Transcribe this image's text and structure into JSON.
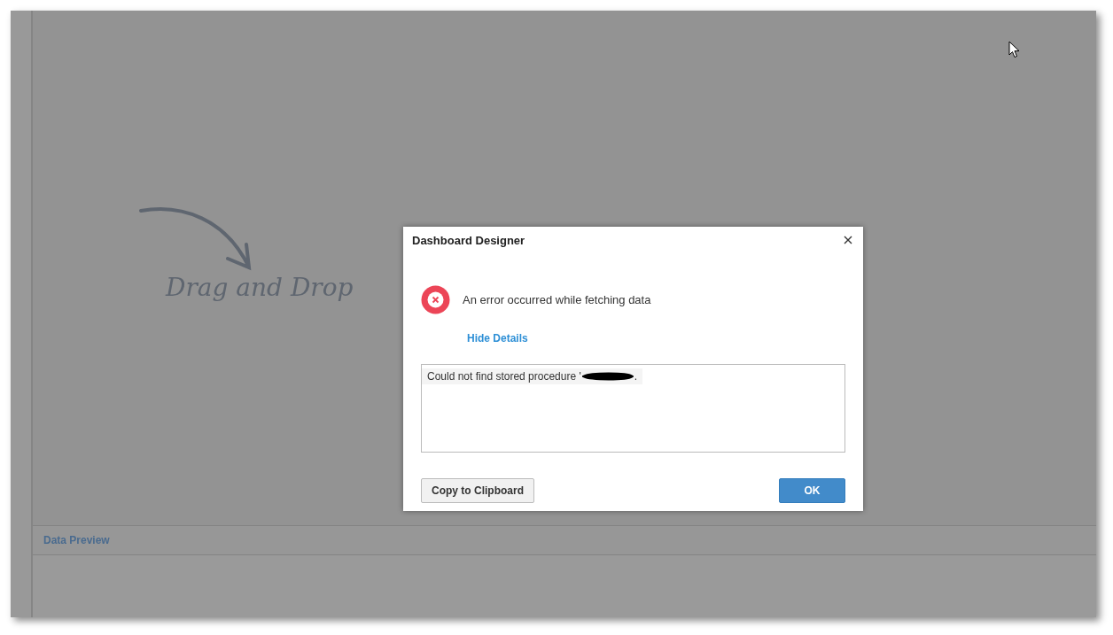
{
  "canvas": {
    "hint": "Drag and Drop"
  },
  "data_preview": {
    "title": "Data Preview"
  },
  "dialog": {
    "title": "Dashboard Designer",
    "message": "An error occurred while fetching data",
    "details_link": "Hide Details",
    "details": {
      "text": "Could not find stored procedure '",
      "end": "."
    },
    "buttons": [
      {
        "label": "Copy to Clipboard",
        "kind": "secondary"
      },
      {
        "label": "OK",
        "kind": "primary"
      }
    ]
  }
}
